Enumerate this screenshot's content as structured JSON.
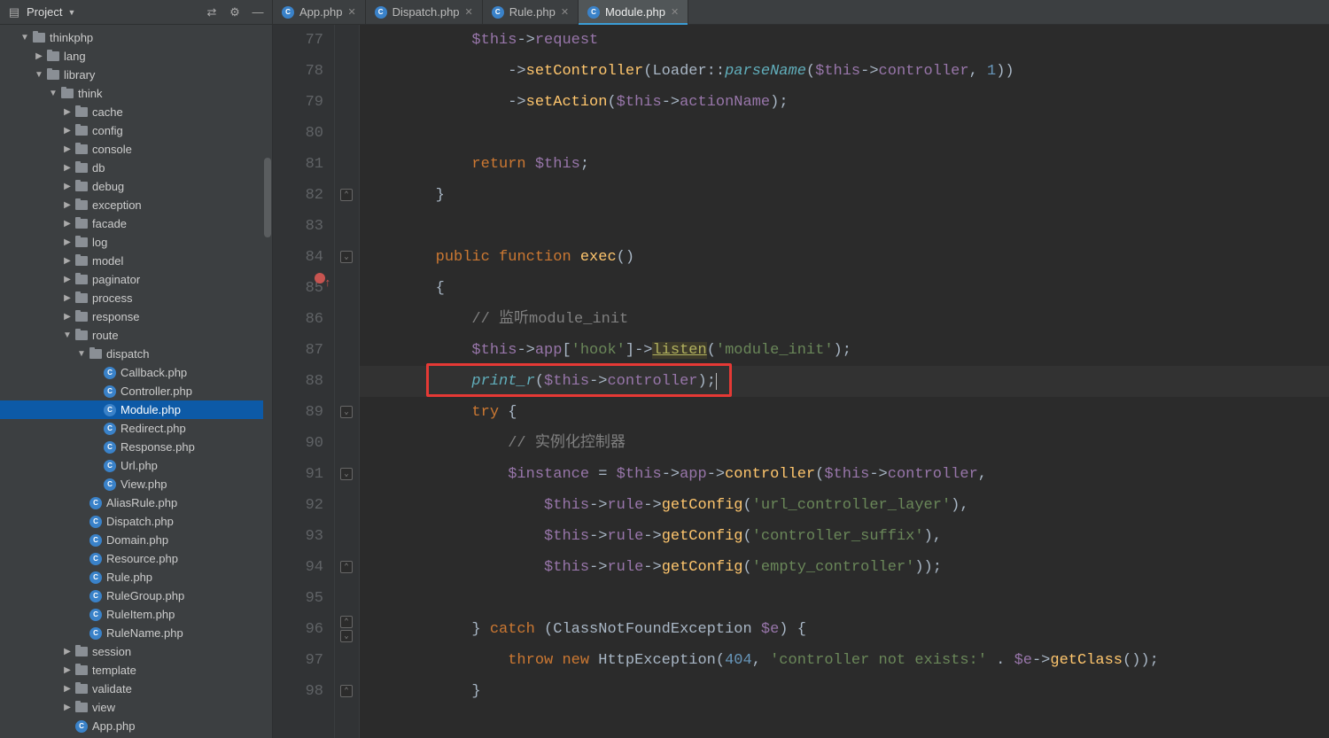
{
  "toolbar": {
    "project_label": "Project"
  },
  "tree": [
    {
      "d": 1,
      "t": "folder",
      "l": "thinkphp",
      "e": true
    },
    {
      "d": 2,
      "t": "folder",
      "l": "lang",
      "e": false
    },
    {
      "d": 2,
      "t": "folder",
      "l": "library",
      "e": true
    },
    {
      "d": 3,
      "t": "folder",
      "l": "think",
      "e": true
    },
    {
      "d": 4,
      "t": "folder",
      "l": "cache",
      "e": false
    },
    {
      "d": 4,
      "t": "folder",
      "l": "config",
      "e": false
    },
    {
      "d": 4,
      "t": "folder",
      "l": "console",
      "e": false
    },
    {
      "d": 4,
      "t": "folder",
      "l": "db",
      "e": false
    },
    {
      "d": 4,
      "t": "folder",
      "l": "debug",
      "e": false
    },
    {
      "d": 4,
      "t": "folder",
      "l": "exception",
      "e": false
    },
    {
      "d": 4,
      "t": "folder",
      "l": "facade",
      "e": false
    },
    {
      "d": 4,
      "t": "folder",
      "l": "log",
      "e": false
    },
    {
      "d": 4,
      "t": "folder",
      "l": "model",
      "e": false
    },
    {
      "d": 4,
      "t": "folder",
      "l": "paginator",
      "e": false
    },
    {
      "d": 4,
      "t": "folder",
      "l": "process",
      "e": false
    },
    {
      "d": 4,
      "t": "folder",
      "l": "response",
      "e": false
    },
    {
      "d": 4,
      "t": "folder",
      "l": "route",
      "e": true
    },
    {
      "d": 5,
      "t": "folder",
      "l": "dispatch",
      "e": true
    },
    {
      "d": 6,
      "t": "php",
      "l": "Callback.php"
    },
    {
      "d": 6,
      "t": "php",
      "l": "Controller.php"
    },
    {
      "d": 6,
      "t": "php",
      "l": "Module.php",
      "sel": true
    },
    {
      "d": 6,
      "t": "php",
      "l": "Redirect.php"
    },
    {
      "d": 6,
      "t": "php",
      "l": "Response.php"
    },
    {
      "d": 6,
      "t": "php",
      "l": "Url.php"
    },
    {
      "d": 6,
      "t": "php",
      "l": "View.php"
    },
    {
      "d": 5,
      "t": "php",
      "l": "AliasRule.php"
    },
    {
      "d": 5,
      "t": "php",
      "l": "Dispatch.php"
    },
    {
      "d": 5,
      "t": "php",
      "l": "Domain.php"
    },
    {
      "d": 5,
      "t": "php",
      "l": "Resource.php"
    },
    {
      "d": 5,
      "t": "php",
      "l": "Rule.php"
    },
    {
      "d": 5,
      "t": "php",
      "l": "RuleGroup.php"
    },
    {
      "d": 5,
      "t": "php",
      "l": "RuleItem.php"
    },
    {
      "d": 5,
      "t": "php",
      "l": "RuleName.php"
    },
    {
      "d": 4,
      "t": "folder",
      "l": "session",
      "e": false
    },
    {
      "d": 4,
      "t": "folder",
      "l": "template",
      "e": false
    },
    {
      "d": 4,
      "t": "folder",
      "l": "validate",
      "e": false
    },
    {
      "d": 4,
      "t": "folder",
      "l": "view",
      "e": false
    },
    {
      "d": 4,
      "t": "php",
      "l": "App.php"
    }
  ],
  "tabs": [
    {
      "l": "App.php",
      "a": false
    },
    {
      "l": "Dispatch.php",
      "a": false
    },
    {
      "l": "Rule.php",
      "a": false
    },
    {
      "l": "Module.php",
      "a": true
    }
  ],
  "code": {
    "start": 77,
    "lines": [
      {
        "n": 77,
        "h": "            <span class='var'>$this</span><span class='op'>-&gt;</span><span class='var'>request</span>"
      },
      {
        "n": 78,
        "h": "                <span class='op'>-&gt;</span><span class='fn'>setController</span>(Loader::<span class='fn call-i'>parseName</span>(<span class='var'>$this</span><span class='op'>-&gt;</span><span class='var'>controller</span>, <span class='num'>1</span>))"
      },
      {
        "n": 79,
        "h": "                <span class='op'>-&gt;</span><span class='fn'>setAction</span>(<span class='var'>$this</span><span class='op'>-&gt;</span><span class='var'>actionName</span>);"
      },
      {
        "n": 80,
        "h": ""
      },
      {
        "n": 81,
        "h": "            <span class='kw'>return</span> <span class='var'>$this</span>;"
      },
      {
        "n": 82,
        "h": "        }",
        "fold": "up"
      },
      {
        "n": 83,
        "h": ""
      },
      {
        "n": 84,
        "h": "        <span class='kw'>public function</span> <span class='fn'>exec</span>()",
        "override": true,
        "fold": "down"
      },
      {
        "n": 85,
        "h": "        {"
      },
      {
        "n": 86,
        "h": "            <span class='cm'>// 监听module_init</span>"
      },
      {
        "n": 87,
        "h": "            <span class='var'>$this</span><span class='op'>-&gt;</span><span class='var'>app</span>[<span class='str'>'hook'</span>]<span class='op'>-&gt;</span><span class='listen'>listen</span>(<span class='str'>'module_init'</span>);"
      },
      {
        "n": 88,
        "h": "            <span class='call-i'>print_r</span>(<span class='var'>$this</span><span class='op'>-&gt;</span><span class='var'>controller</span>);<span style='border-left:1px solid #bbb;'>&#8203;</span>",
        "current": true,
        "boxed": true
      },
      {
        "n": 89,
        "h": "            <span class='kw'>try</span> {",
        "fold": "down"
      },
      {
        "n": 90,
        "h": "                <span class='cm'>// 实例化控制器</span>"
      },
      {
        "n": 91,
        "h": "                <span class='var'>$instance</span> = <span class='var'>$this</span><span class='op'>-&gt;</span><span class='var'>app</span><span class='op'>-&gt;</span><span class='fn'>controller</span>(<span class='var'>$this</span><span class='op'>-&gt;</span><span class='var'>controller</span>,",
        "fold": "down"
      },
      {
        "n": 92,
        "h": "                    <span class='var'>$this</span><span class='op'>-&gt;</span><span class='var'>rule</span><span class='op'>-&gt;</span><span class='fn'>getConfig</span>(<span class='str'>'url_controller_layer'</span>),"
      },
      {
        "n": 93,
        "h": "                    <span class='var'>$this</span><span class='op'>-&gt;</span><span class='var'>rule</span><span class='op'>-&gt;</span><span class='fn'>getConfig</span>(<span class='str'>'controller_suffix'</span>),"
      },
      {
        "n": 94,
        "h": "                    <span class='var'>$this</span><span class='op'>-&gt;</span><span class='var'>rule</span><span class='op'>-&gt;</span><span class='fn'>getConfig</span>(<span class='str'>'empty_controller'</span>));",
        "fold": "up"
      },
      {
        "n": 95,
        "h": ""
      },
      {
        "n": 96,
        "h": "            } <span class='kw'>catch</span> (ClassNotFoundException <span class='var'>$e</span>) {",
        "fold": "both"
      },
      {
        "n": 97,
        "h": "                <span class='kw'>throw new</span> HttpException(<span class='num'>404</span>, <span class='str'>'controller not exists:'</span> . <span class='var'>$e</span><span class='op'>-&gt;</span><span class='fn'>getClass</span>());"
      },
      {
        "n": 98,
        "h": "            }",
        "fold": "up"
      }
    ]
  }
}
